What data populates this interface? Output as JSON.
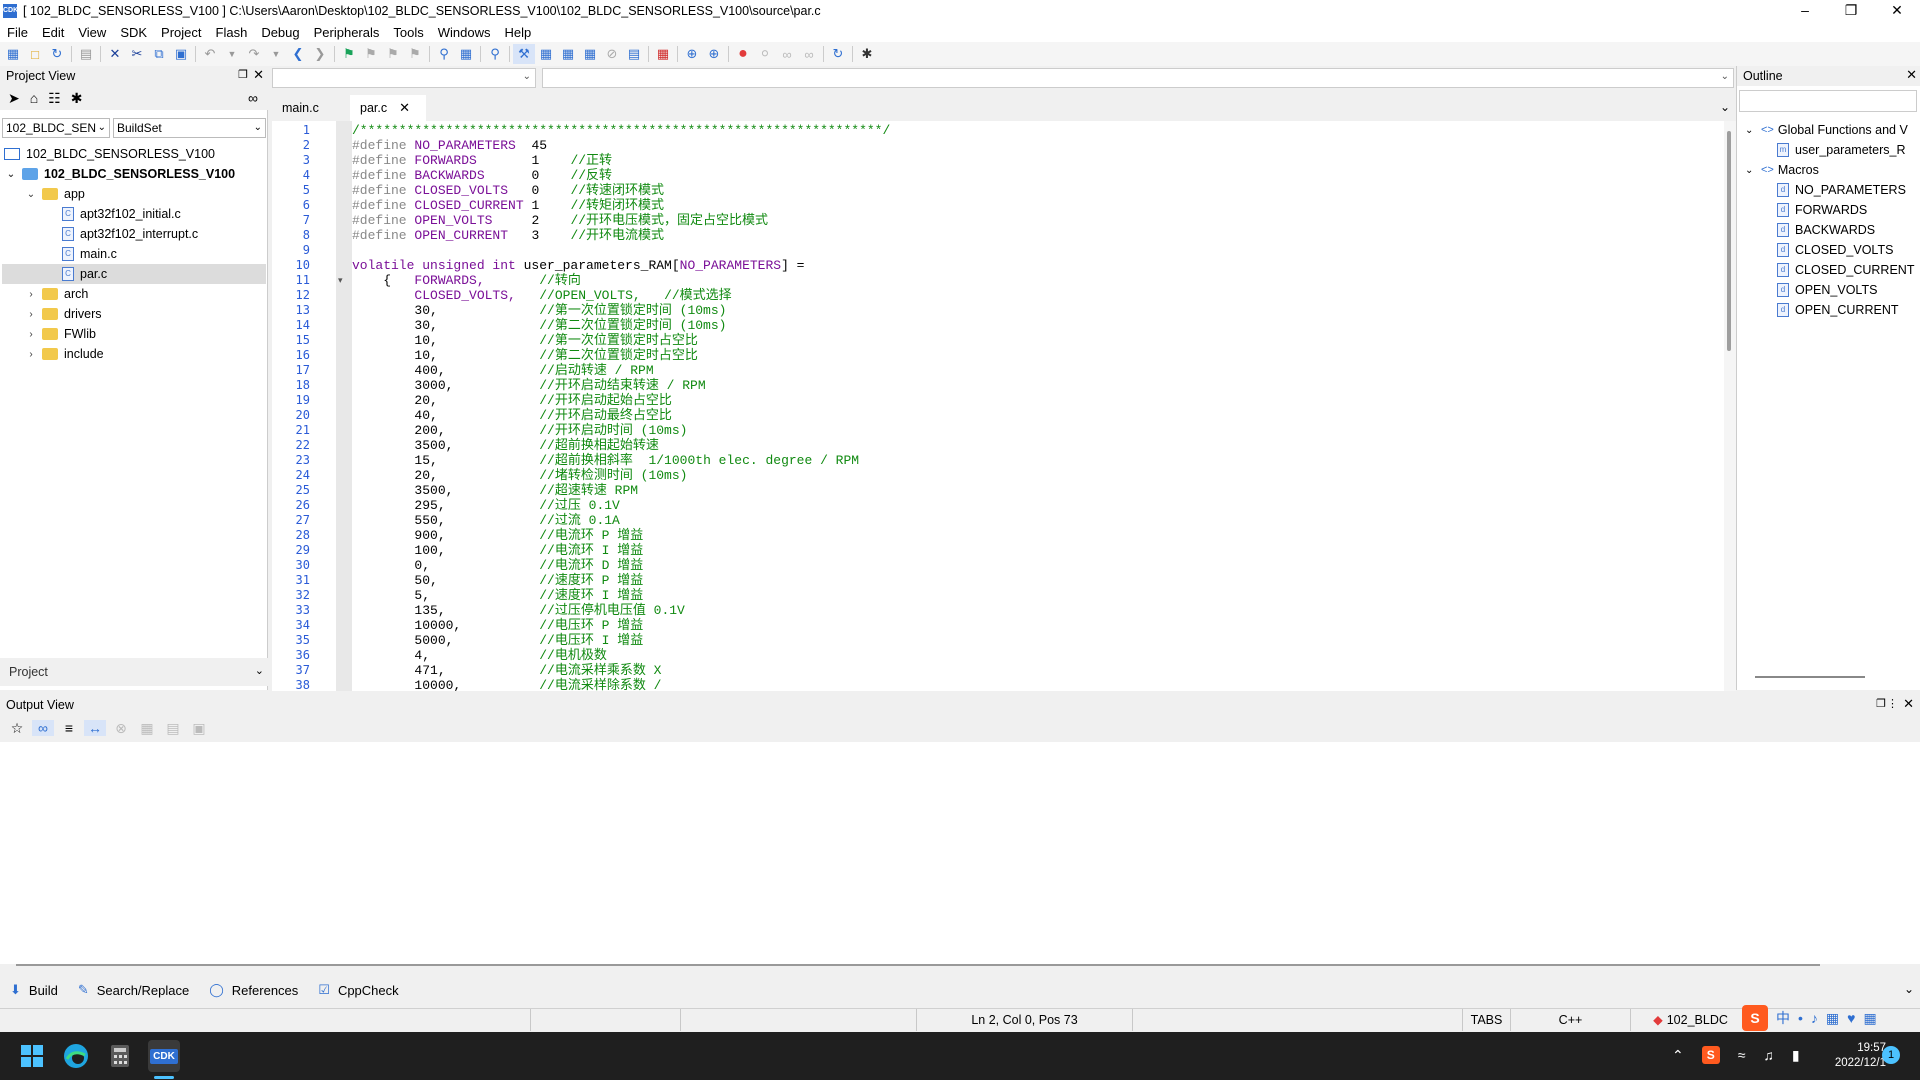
{
  "window": {
    "title": "[ 102_BLDC_SENSORLESS_V100 ] C:\\Users\\Aaron\\Desktop\\102_BLDC_SENSORLESS_V100\\102_BLDC_SENSORLESS_V100\\source\\par.c",
    "app_badge": "CDK"
  },
  "menu": [
    "File",
    "Edit",
    "View",
    "SDK",
    "Project",
    "Flash",
    "Debug",
    "Peripherals",
    "Tools",
    "Windows",
    "Help"
  ],
  "project_view": {
    "header": "Project View",
    "project_select": "102_BLDC_SEN",
    "build_select": "BuildSet",
    "footer_label": "Project",
    "tree": {
      "workspace": "102_BLDC_SENSORLESS_V100",
      "project": "102_BLDC_SENSORLESS_V100",
      "app": "app",
      "files": [
        "apt32f102_initial.c",
        "apt32f102_interrupt.c",
        "main.c",
        "par.c"
      ],
      "folders": [
        "arch",
        "drivers",
        "FWlib",
        "include"
      ]
    }
  },
  "editor": {
    "tabs": [
      "main.c",
      "par.c"
    ],
    "line_numbers": [
      "1",
      "2",
      "3",
      "4",
      "5",
      "6",
      "7",
      "8",
      "9",
      "10",
      "11",
      "12",
      "13",
      "14",
      "15",
      "16",
      "17",
      "18",
      "19",
      "20",
      "21",
      "22",
      "23",
      "24",
      "25",
      "26",
      "27",
      "28",
      "29",
      "30",
      "31",
      "32",
      "33",
      "34",
      "35",
      "36",
      "37",
      "38"
    ],
    "lines": [
      {
        "kind": "comment",
        "text": "/*******************************************************************/"
      },
      {
        "kind": "define",
        "name": "NO_PARAMETERS",
        "value": "45",
        "comment": ""
      },
      {
        "kind": "define",
        "name": "FORWARDS",
        "value": "1",
        "comment": "//正转"
      },
      {
        "kind": "define",
        "name": "BACKWARDS",
        "value": "0",
        "comment": "//反转"
      },
      {
        "kind": "define",
        "name": "CLOSED_VOLTS",
        "value": "0",
        "comment": "//转速闭环模式"
      },
      {
        "kind": "define",
        "name": "CLOSED_CURRENT",
        "value": "1",
        "comment": "//转矩闭环模式"
      },
      {
        "kind": "define",
        "name": "OPEN_VOLTS",
        "value": "2",
        "comment": "//开环电压模式，固定占空比模式"
      },
      {
        "kind": "define",
        "name": "OPEN_CURRENT",
        "value": "3",
        "comment": "//开环电流模式"
      },
      {
        "kind": "blank",
        "text": ""
      },
      {
        "kind": "decl",
        "kw": "volatile unsigned int",
        "rest": " user_parameters_RAM[",
        "macro": "NO_PARAMETERS",
        "tail": "] ="
      },
      {
        "kind": "entry",
        "prefix": "{",
        "value": "FORWARDS,",
        "comment": "//转向"
      },
      {
        "kind": "entry",
        "prefix": "",
        "value": "CLOSED_VOLTS,",
        "comment": "//OPEN_VOLTS,   //模式选择"
      },
      {
        "kind": "entry",
        "prefix": "",
        "value": "30,",
        "comment": "//第一次位置锁定时间 (10ms)"
      },
      {
        "kind": "entry",
        "prefix": "",
        "value": "30,",
        "comment": "//第二次位置锁定时间 (10ms)"
      },
      {
        "kind": "entry",
        "prefix": "",
        "value": "10,",
        "comment": "//第一次位置锁定时占空比"
      },
      {
        "kind": "entry",
        "prefix": "",
        "value": "10,",
        "comment": "//第二次位置锁定时占空比"
      },
      {
        "kind": "entry",
        "prefix": "",
        "value": "400,",
        "comment": "//启动转速 / RPM"
      },
      {
        "kind": "entry",
        "prefix": "",
        "value": "3000,",
        "comment": "//开环启动结束转速 / RPM"
      },
      {
        "kind": "entry",
        "prefix": "",
        "value": "20,",
        "comment": "//开环启动起始占空比"
      },
      {
        "kind": "entry",
        "prefix": "",
        "value": "40,",
        "comment": "//开环启动最终占空比"
      },
      {
        "kind": "entry",
        "prefix": "",
        "value": "200,",
        "comment": "//开环启动时间 (10ms)"
      },
      {
        "kind": "entry",
        "prefix": "",
        "value": "3500,",
        "comment": "//超前换相起始转速"
      },
      {
        "kind": "entry",
        "prefix": "",
        "value": "15,",
        "comment": "//超前换相斜率  1/1000th elec. degree / RPM"
      },
      {
        "kind": "entry",
        "prefix": "",
        "value": "20,",
        "comment": "//堵转检测时间 (10ms)"
      },
      {
        "kind": "entry",
        "prefix": "",
        "value": "3500,",
        "comment": "//超速转速 RPM"
      },
      {
        "kind": "entry",
        "prefix": "",
        "value": "295,",
        "comment": "//过压 0.1V"
      },
      {
        "kind": "entry",
        "prefix": "",
        "value": "550,",
        "comment": "//过流 0.1A"
      },
      {
        "kind": "entry",
        "prefix": "",
        "value": "900,",
        "comment": "//电流环 P 增益"
      },
      {
        "kind": "entry",
        "prefix": "",
        "value": "100,",
        "comment": "//电流环 I 增益"
      },
      {
        "kind": "entry",
        "prefix": "",
        "value": "0,",
        "comment": "//电流环 D 增益"
      },
      {
        "kind": "entry",
        "prefix": "",
        "value": "50,",
        "comment": "//速度环 P 增益"
      },
      {
        "kind": "entry",
        "prefix": "",
        "value": "5,",
        "comment": "//速度环 I 增益"
      },
      {
        "kind": "entry",
        "prefix": "",
        "value": "135,",
        "comment": "//过压停机电压值 0.1V"
      },
      {
        "kind": "entry",
        "prefix": "",
        "value": "10000,",
        "comment": "//电压环 P 增益"
      },
      {
        "kind": "entry",
        "prefix": "",
        "value": "5000,",
        "comment": "//电压环 I 增益"
      },
      {
        "kind": "entry",
        "prefix": "",
        "value": "4,",
        "comment": "//电机极数"
      },
      {
        "kind": "entry",
        "prefix": "",
        "value": "471,",
        "comment": "//电流采样乘系数 X"
      },
      {
        "kind": "entry",
        "prefix": "",
        "value": "10000,",
        "comment": "//电流采样除系数 /"
      }
    ]
  },
  "outline": {
    "header": "Outline",
    "group_functions": "Global Functions and V",
    "func_item": "user_parameters_R",
    "group_macros": "Macros",
    "macros": [
      "NO_PARAMETERS",
      "FORWARDS",
      "BACKWARDS",
      "CLOSED_VOLTS",
      "CLOSED_CURRENT",
      "OPEN_VOLTS",
      "OPEN_CURRENT"
    ]
  },
  "output_view": {
    "header": "Output View"
  },
  "bottom_tabs": [
    "Build",
    "Search/Replace",
    "References",
    "CppCheck"
  ],
  "status": {
    "position": "Ln 2, Col 0, Pos 73",
    "tabs": "TABS",
    "lang": "C++",
    "project": "102_BLDC"
  },
  "taskbar": {
    "time": "19:57",
    "date": "2022/12/1",
    "notif": "1",
    "cdk_label": "CDK"
  },
  "colors": {
    "accent": "#2f6fd1",
    "comment": "#118a11",
    "keyword": "#7a0f97",
    "linenum": "#2a5bd7"
  }
}
